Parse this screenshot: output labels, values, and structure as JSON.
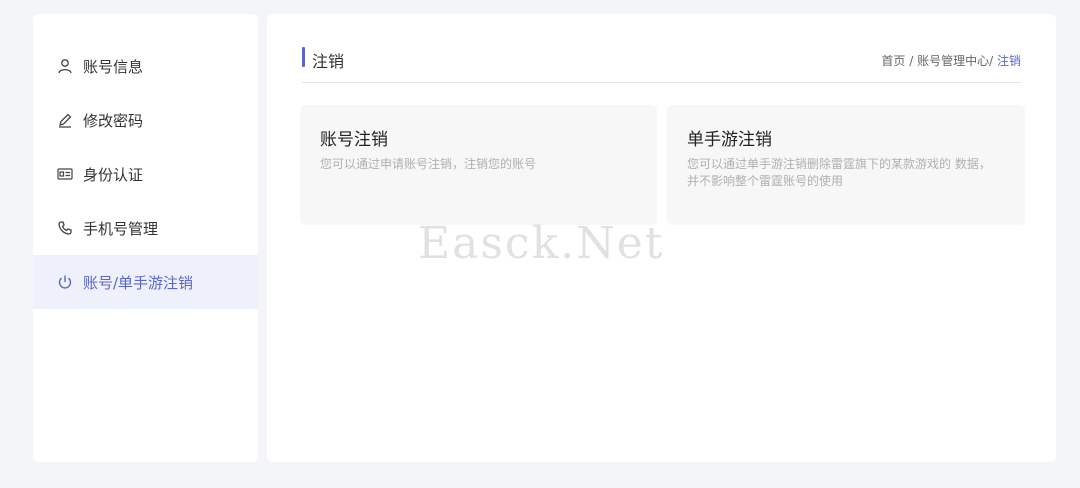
{
  "sidebar": {
    "items": [
      {
        "label": "账号信息",
        "icon": "user-icon"
      },
      {
        "label": "修改密码",
        "icon": "pencil-icon"
      },
      {
        "label": "身份认证",
        "icon": "id-card-icon"
      },
      {
        "label": "手机号管理",
        "icon": "phone-icon"
      },
      {
        "label": "账号/单手游注销",
        "icon": "power-icon",
        "active": true
      }
    ]
  },
  "header": {
    "title": "注销",
    "breadcrumb": {
      "home": "首页",
      "sep1": " / ",
      "center": "账号管理中心",
      "sep2": "/ ",
      "current": "注销"
    }
  },
  "cards": [
    {
      "title": "账号注销",
      "desc": "您可以通过申请账号注销，注销您的账号"
    },
    {
      "title": "单手游注销",
      "desc": "您可以通过单手游注销删除雷霆旗下的某款游戏的 数据，并不影响整个雷霆账号的使用"
    }
  ],
  "watermark": "Easck.Net",
  "colors": {
    "accent": "#5b66cc",
    "active_bg": "#eef1fb",
    "page_bg": "#f4f5f9"
  }
}
